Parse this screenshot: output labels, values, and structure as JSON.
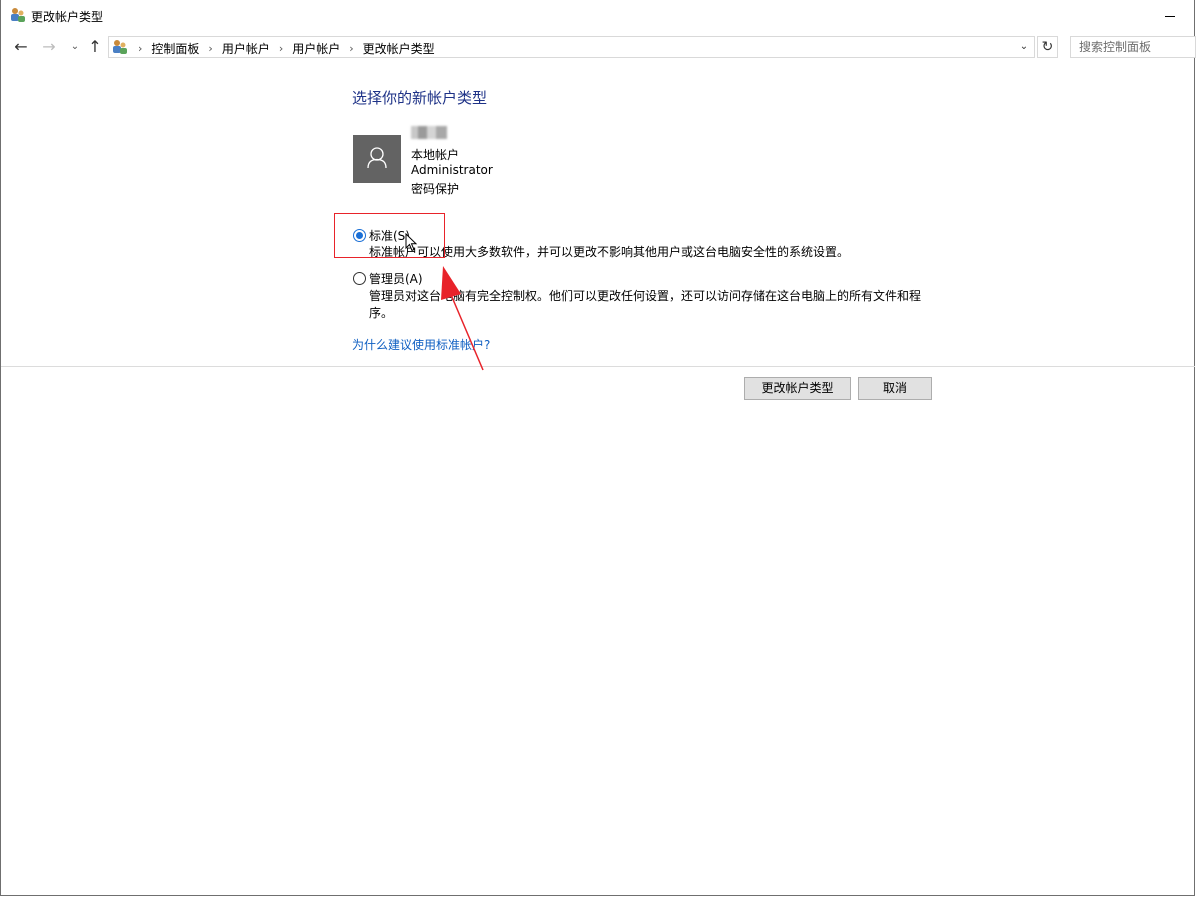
{
  "window": {
    "title": "更改帐户类型",
    "icon": "users-icon"
  },
  "navigation": {
    "breadcrumb": [
      "控制面板",
      "用户帐户",
      "用户帐户",
      "更改帐户类型"
    ],
    "search_placeholder": "搜索控制面板"
  },
  "content": {
    "heading": "选择你的新帐户类型",
    "account": {
      "type": "本地帐户",
      "role": "Administrator",
      "password_status": "密码保护"
    },
    "options": [
      {
        "label": "标准(S)",
        "description": "标准帐户可以使用大多数软件，并可以更改不影响其他用户或这台电脑安全性的系统设置。",
        "selected": true
      },
      {
        "label": "管理员(A)",
        "description": "管理员对这台电脑有完全控制权。他们可以更改任何设置，还可以访问存储在这台电脑上的所有文件和程序。",
        "selected": false
      }
    ],
    "why_link": "为什么建议使用标准帐户?"
  },
  "buttons": {
    "change": "更改帐户类型",
    "cancel": "取消"
  },
  "colors": {
    "heading": "#1e3287",
    "link": "#0f5fc2",
    "radio_selected": "#1a6fd6",
    "annotation": "#e8232a"
  }
}
